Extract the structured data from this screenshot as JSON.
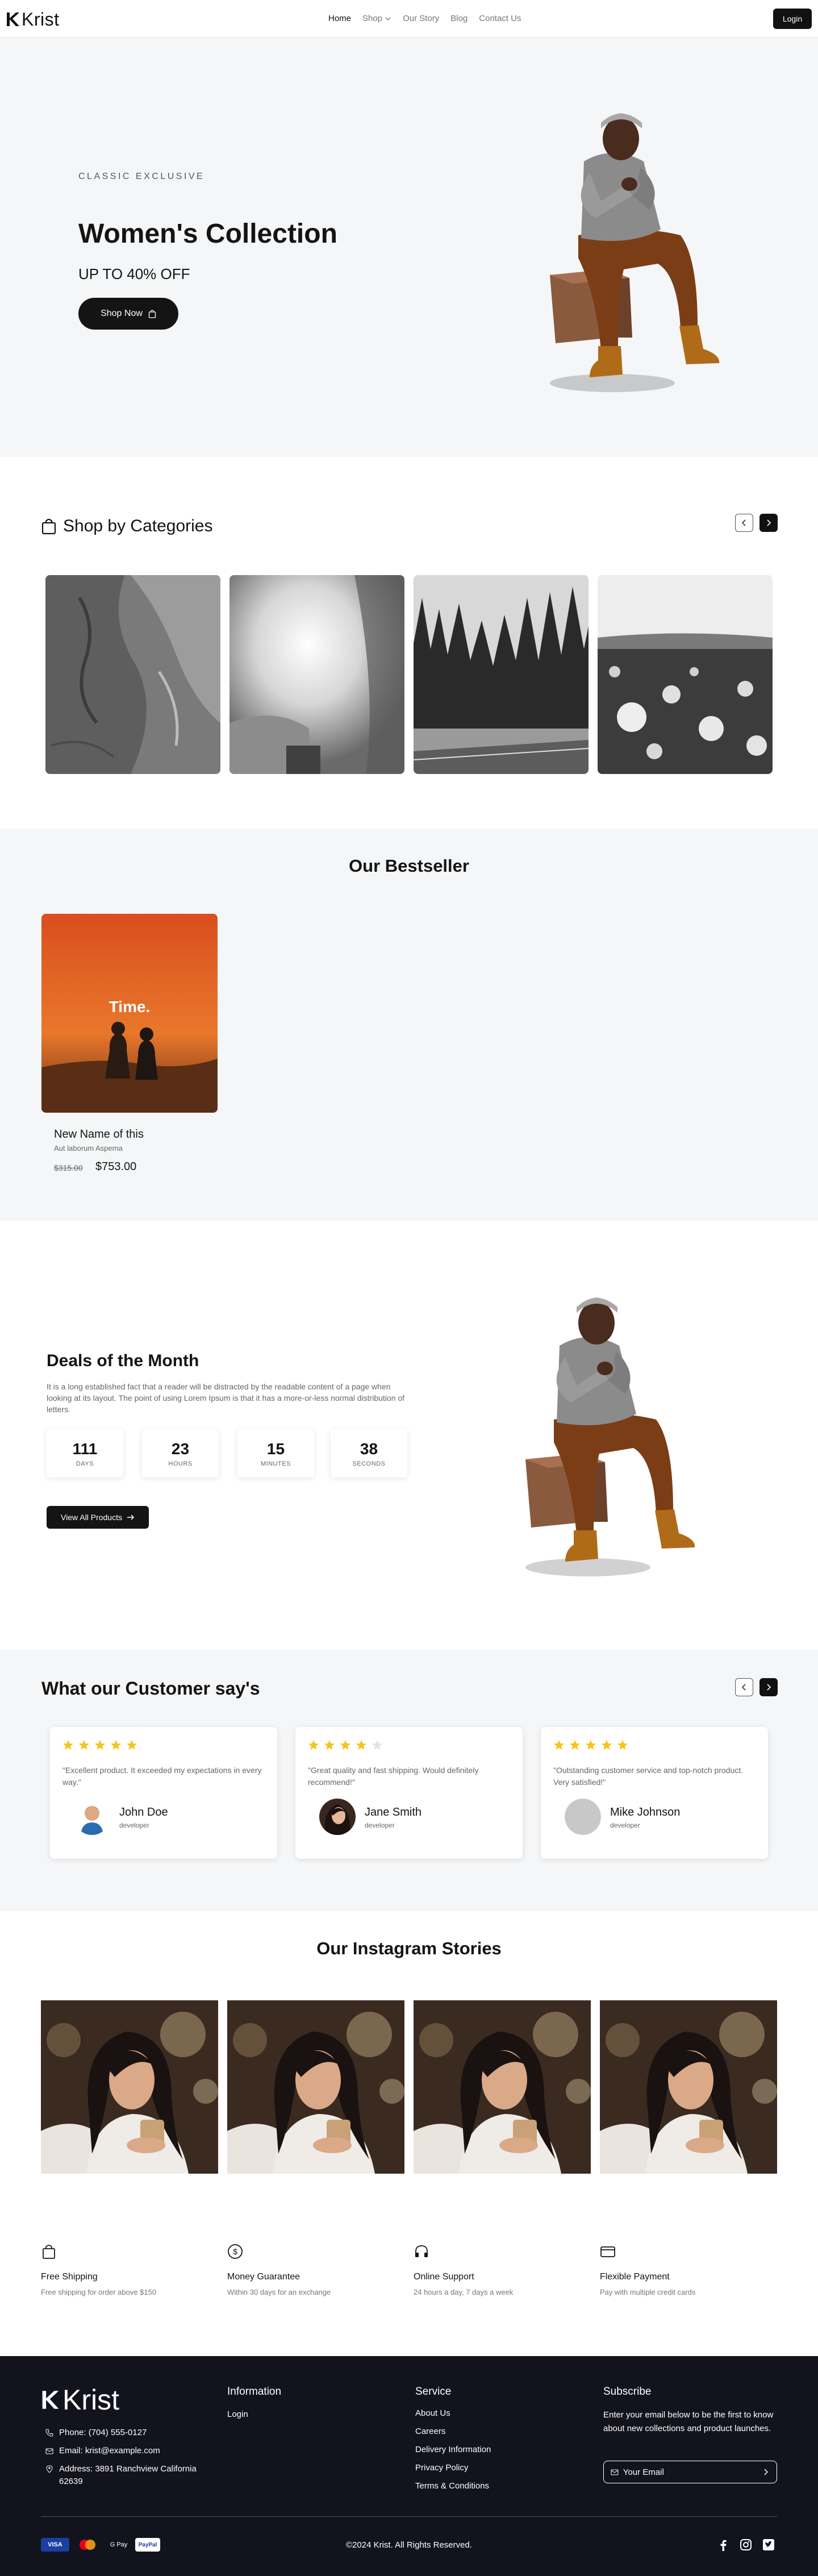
{
  "nav": {
    "logo": "Krist",
    "links": [
      "Home",
      "Shop",
      "Our Story",
      "Blog",
      "Contact Us"
    ],
    "login": "Login"
  },
  "hero": {
    "kicker": "CLASSIC EXCLUSIVE",
    "title": "Women's Collection",
    "subtitle": "UP TO 40% OFF",
    "cta": "Shop Now"
  },
  "categories": {
    "title": "Shop by Categories"
  },
  "bestseller": {
    "title": "Our Bestseller",
    "product": {
      "image_text": "Time.",
      "name": "New Name of this",
      "brand": "Aut laborum Aspema",
      "old_price": "$315.00",
      "price": "$753.00"
    }
  },
  "deals": {
    "title": "Deals of the Month",
    "description": "It is a long established fact that a reader will be distracted by the readable content of a page when looking at its layout. The point of using Lorem Ipsum is that it has a more-or-less normal distribution of letters.",
    "countdown": [
      {
        "value": "111",
        "label": "DAYS"
      },
      {
        "value": "23",
        "label": "HOURS"
      },
      {
        "value": "15",
        "label": "MINUTES"
      },
      {
        "value": "38",
        "label": "SECONDS"
      }
    ],
    "cta": "View All Products"
  },
  "testimonials": {
    "title": "What our Customer say's",
    "items": [
      {
        "rating": 5,
        "quote": "\"Excellent product. It exceeded my expectations in every way.\"",
        "name": "John Doe",
        "role": "developer"
      },
      {
        "rating": 4,
        "quote": "\"Great quality and fast shipping. Would definitely recommend!\"",
        "name": "Jane Smith",
        "role": "developer"
      },
      {
        "rating": 5,
        "quote": "\"Outstanding customer service and top-notch product. Very satisfied!\"",
        "name": "Mike Johnson",
        "role": "developer"
      }
    ]
  },
  "instagram": {
    "title": "Our Instagram Stories"
  },
  "features": [
    {
      "icon": "shopping-bag-icon",
      "title": "Free Shipping",
      "desc": "Free shipping for order above $150"
    },
    {
      "icon": "dollar-icon",
      "title": "Money Guarantee",
      "desc": "Within 30 days for an exchange"
    },
    {
      "icon": "headphones-icon",
      "title": "Online Support",
      "desc": "24 hours a day, 7 days a week"
    },
    {
      "icon": "credit-card-icon",
      "title": "Flexible Payment",
      "desc": "Pay with multiple credit cards"
    }
  ],
  "footer": {
    "logo": "Krist",
    "phone": "Phone: (704) 555-0127",
    "email": "Email: krist@example.com",
    "address": "Address: 3891 Ranchview California 62639",
    "information": {
      "title": "Information",
      "links": [
        "Login"
      ]
    },
    "service": {
      "title": "Service",
      "links": [
        "About Us",
        "Careers",
        "Delivery Information",
        "Privacy Policy",
        "Terms & Conditions"
      ]
    },
    "subscribe": {
      "title": "Subscribe",
      "text": "Enter your email below to be the first to know about new collections and product launches.",
      "placeholder": "Your Email"
    },
    "payments": [
      "VISA",
      "G Pay",
      "PayPal"
    ],
    "copyright": "©2024 Krist. All Rights Reserved."
  },
  "colors": {
    "dark": "#141414",
    "light_section": "#f5f6f7",
    "footer_bg": "#13131d",
    "star": "#f5c518"
  }
}
